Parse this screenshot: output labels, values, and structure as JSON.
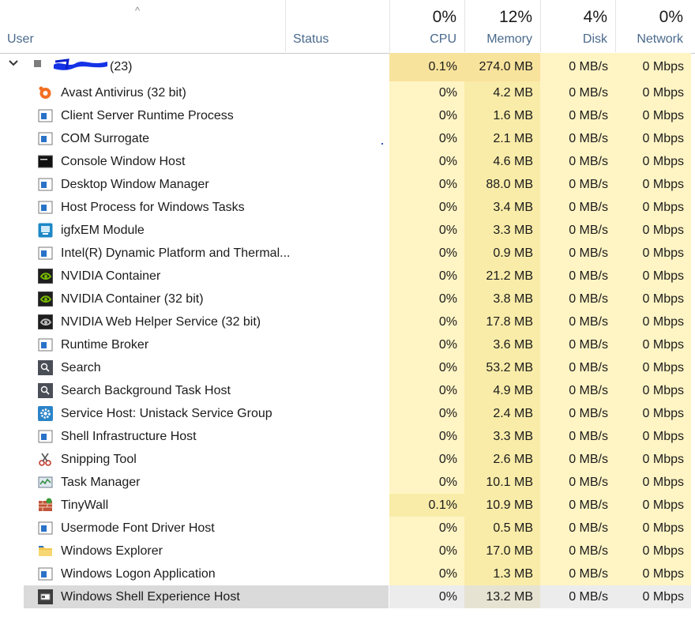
{
  "header": {
    "sort_indicator": "^",
    "user_label": "User",
    "status_label": "Status",
    "cpu": {
      "percent": "0%",
      "label": "CPU"
    },
    "memory": {
      "percent": "12%",
      "label": "Memory"
    },
    "disk": {
      "percent": "4%",
      "label": "Disk"
    },
    "network": {
      "percent": "0%",
      "label": "Network"
    }
  },
  "group": {
    "expand_glyph": "⌄",
    "count": "(23)",
    "cpu": "0.1%",
    "memory": "274.0 MB",
    "disk": "0 MB/s",
    "network": "0 Mbps"
  },
  "processes": [
    {
      "name": "Avast Antivirus (32 bit)",
      "icon": "avast-icon",
      "cpu": "0%",
      "memory": "4.2 MB",
      "disk": "0 MB/s",
      "network": "0 Mbps"
    },
    {
      "name": "Client Server Runtime Process",
      "icon": "window-icon",
      "cpu": "0%",
      "memory": "1.6 MB",
      "disk": "0 MB/s",
      "network": "0 Mbps"
    },
    {
      "name": "COM Surrogate",
      "icon": "window-icon",
      "cpu": "0%",
      "memory": "2.1 MB",
      "disk": "0 MB/s",
      "network": "0 Mbps"
    },
    {
      "name": "Console Window Host",
      "icon": "console-icon",
      "cpu": "0%",
      "memory": "4.6 MB",
      "disk": "0 MB/s",
      "network": "0 Mbps"
    },
    {
      "name": "Desktop Window Manager",
      "icon": "window-icon",
      "cpu": "0%",
      "memory": "88.0 MB",
      "disk": "0 MB/s",
      "network": "0 Mbps"
    },
    {
      "name": "Host Process for Windows Tasks",
      "icon": "window-icon",
      "cpu": "0%",
      "memory": "3.4 MB",
      "disk": "0 MB/s",
      "network": "0 Mbps"
    },
    {
      "name": "igfxEM Module",
      "icon": "intel-graphics-icon",
      "cpu": "0%",
      "memory": "3.3 MB",
      "disk": "0 MB/s",
      "network": "0 Mbps"
    },
    {
      "name": "Intel(R) Dynamic Platform and Thermal...",
      "icon": "window-icon",
      "cpu": "0%",
      "memory": "0.9 MB",
      "disk": "0 MB/s",
      "network": "0 Mbps"
    },
    {
      "name": "NVIDIA Container",
      "icon": "nvidia-icon",
      "cpu": "0%",
      "memory": "21.2 MB",
      "disk": "0 MB/s",
      "network": "0 Mbps"
    },
    {
      "name": "NVIDIA Container (32 bit)",
      "icon": "nvidia-icon",
      "cpu": "0%",
      "memory": "3.8 MB",
      "disk": "0 MB/s",
      "network": "0 Mbps"
    },
    {
      "name": "NVIDIA Web Helper Service (32 bit)",
      "icon": "nvidia-web-icon",
      "cpu": "0%",
      "memory": "17.8 MB",
      "disk": "0 MB/s",
      "network": "0 Mbps"
    },
    {
      "name": "Runtime Broker",
      "icon": "window-icon",
      "cpu": "0%",
      "memory": "3.6 MB",
      "disk": "0 MB/s",
      "network": "0 Mbps"
    },
    {
      "name": "Search",
      "icon": "search-icon",
      "cpu": "0%",
      "memory": "53.2 MB",
      "disk": "0 MB/s",
      "network": "0 Mbps"
    },
    {
      "name": "Search Background Task Host",
      "icon": "search-icon",
      "cpu": "0%",
      "memory": "4.9 MB",
      "disk": "0 MB/s",
      "network": "0 Mbps"
    },
    {
      "name": "Service Host: Unistack Service Group",
      "icon": "gear-icon",
      "cpu": "0%",
      "memory": "2.4 MB",
      "disk": "0 MB/s",
      "network": "0 Mbps"
    },
    {
      "name": "Shell Infrastructure Host",
      "icon": "window-icon",
      "cpu": "0%",
      "memory": "3.3 MB",
      "disk": "0 MB/s",
      "network": "0 Mbps"
    },
    {
      "name": "Snipping Tool",
      "icon": "scissors-icon",
      "cpu": "0%",
      "memory": "2.6 MB",
      "disk": "0 MB/s",
      "network": "0 Mbps"
    },
    {
      "name": "Task Manager",
      "icon": "task-manager-icon",
      "cpu": "0%",
      "memory": "10.1 MB",
      "disk": "0 MB/s",
      "network": "0 Mbps"
    },
    {
      "name": "TinyWall",
      "icon": "firewall-icon",
      "cpu": "0.1%",
      "memory": "10.9 MB",
      "disk": "0 MB/s",
      "network": "0 Mbps"
    },
    {
      "name": "Usermode Font Driver Host",
      "icon": "window-icon",
      "cpu": "0%",
      "memory": "0.5 MB",
      "disk": "0 MB/s",
      "network": "0 Mbps"
    },
    {
      "name": "Windows Explorer",
      "icon": "folder-icon",
      "cpu": "0%",
      "memory": "17.0 MB",
      "disk": "0 MB/s",
      "network": "0 Mbps"
    },
    {
      "name": "Windows Logon Application",
      "icon": "window-icon",
      "cpu": "0%",
      "memory": "1.3 MB",
      "disk": "0 MB/s",
      "network": "0 Mbps"
    },
    {
      "name": "Windows Shell Experience Host",
      "icon": "shell-host-icon",
      "cpu": "0%",
      "memory": "13.2 MB",
      "disk": "0 MB/s",
      "network": "0 Mbps"
    }
  ],
  "colors": {
    "heat_light": "#fff4c4",
    "heat_medium": "#f9eca8",
    "heat_strong": "#f8e39c",
    "selected_row": "#dadada",
    "header_label": "#4a6a8c"
  }
}
